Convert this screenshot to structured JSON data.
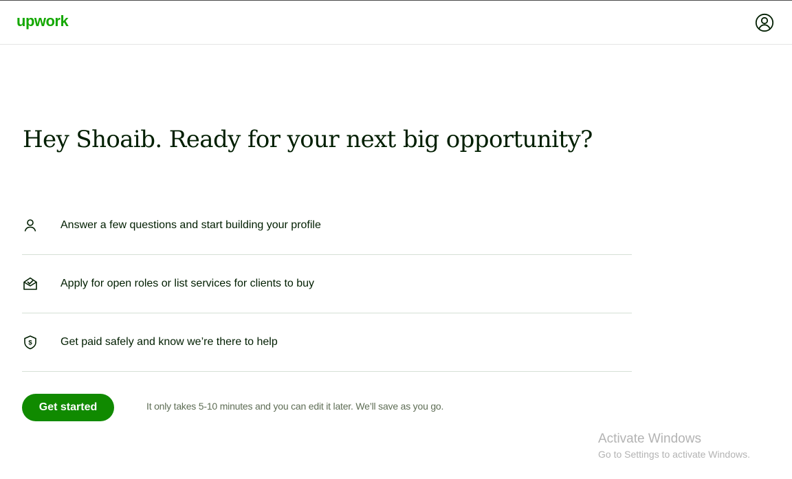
{
  "header": {
    "logo_text": "upwork",
    "account_icon": "user-circle-icon"
  },
  "main": {
    "headline": "Hey Shoaib. Ready for your next big opportunity?",
    "steps": [
      {
        "icon": "person-icon",
        "text": "Answer a few questions and start building your profile"
      },
      {
        "icon": "envelope-check-icon",
        "text": "Apply for open roles or list services for clients to buy"
      },
      {
        "icon": "shield-dollar-icon",
        "text": "Get paid safely and know we’re there to help"
      }
    ],
    "cta_label": "Get started",
    "note": "It only takes 5-10 minutes and you can edit it later. We’ll save as you go."
  },
  "watermark": {
    "title": "Activate Windows",
    "subtitle": "Go to Settings to activate Windows."
  },
  "colors": {
    "brand_green": "#14a800",
    "button_green": "#108a00",
    "text_dark": "#001e00",
    "divider": "#d5e0d5"
  }
}
